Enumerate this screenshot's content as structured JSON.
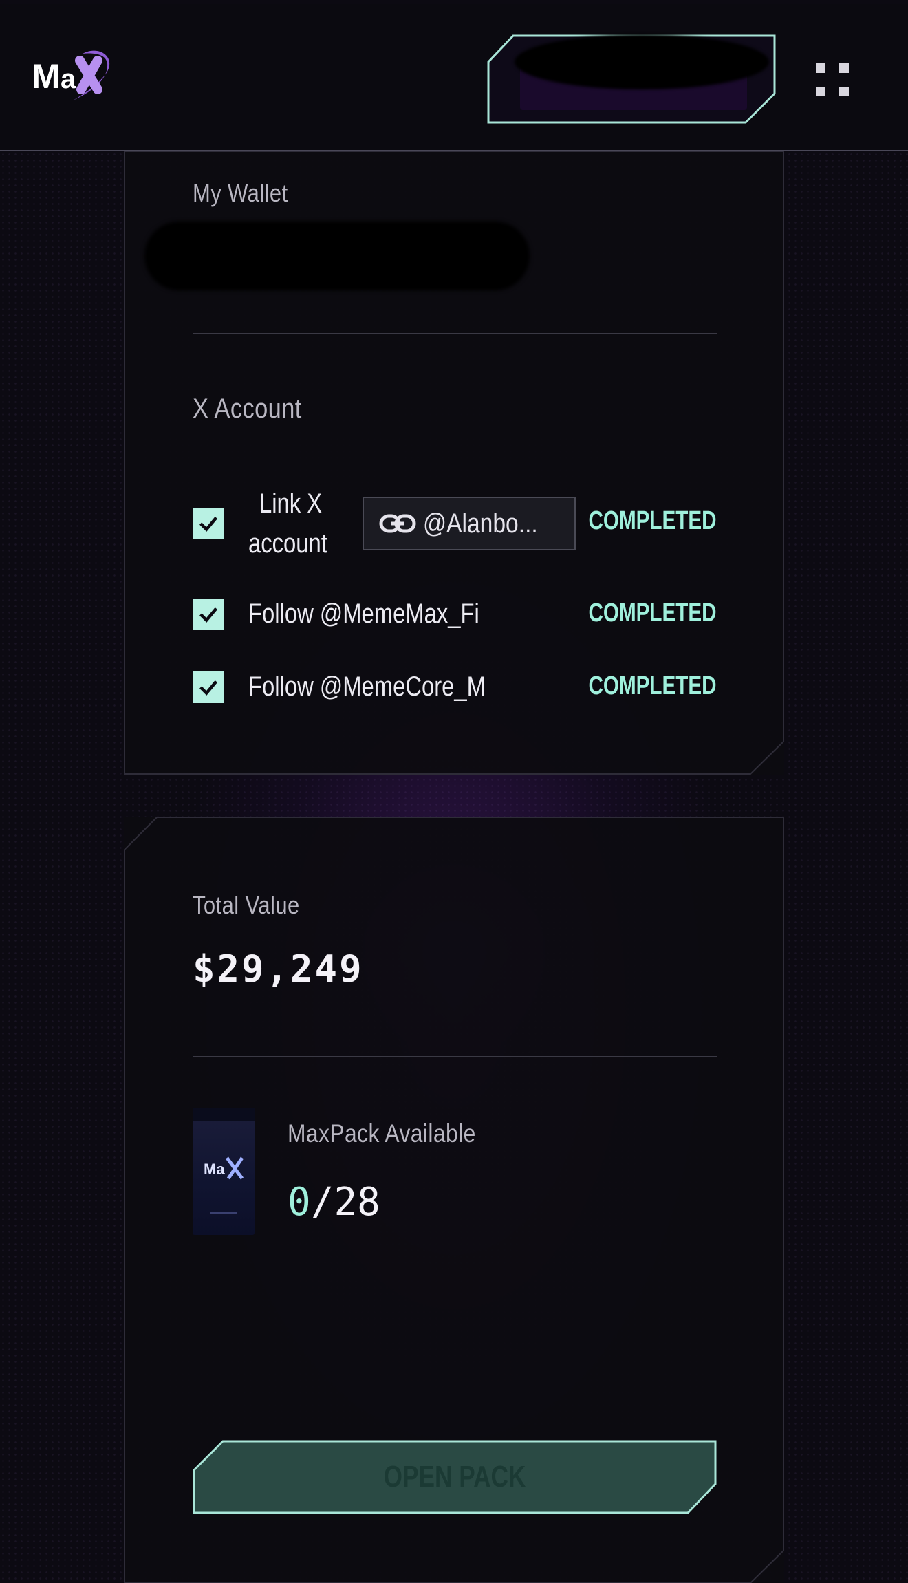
{
  "header": {
    "logo_text": "MaX",
    "menu_icon": "grid-icon"
  },
  "wallet_card": {
    "wallet_label": "My Wallet",
    "x_account_label": "X Account",
    "tasks": [
      {
        "label": "Link X account",
        "label_line1": "Link X",
        "label_line2": "account",
        "handle": "@Alanbo...",
        "status": "COMPLETED"
      },
      {
        "label": "Follow @MemeMax_Fi",
        "status": "COMPLETED"
      },
      {
        "label": "Follow @MemeCore_M",
        "status": "COMPLETED"
      }
    ],
    "link_icon": "link-icon",
    "check_icon": "check-icon"
  },
  "value_card": {
    "total_label": "Total Value",
    "total_value": "$29,249",
    "pack_label": "MaxPack Available",
    "pack_current": "0",
    "pack_separator": "/",
    "pack_total": "28",
    "open_button_label": "OPEN PACK"
  },
  "colors": {
    "accent": "#9ff0dc",
    "checkbox": "#b8f1e3",
    "background": "#0c0a12",
    "purple_glow": "#5c208c",
    "button_fill": "#2a4a44"
  }
}
